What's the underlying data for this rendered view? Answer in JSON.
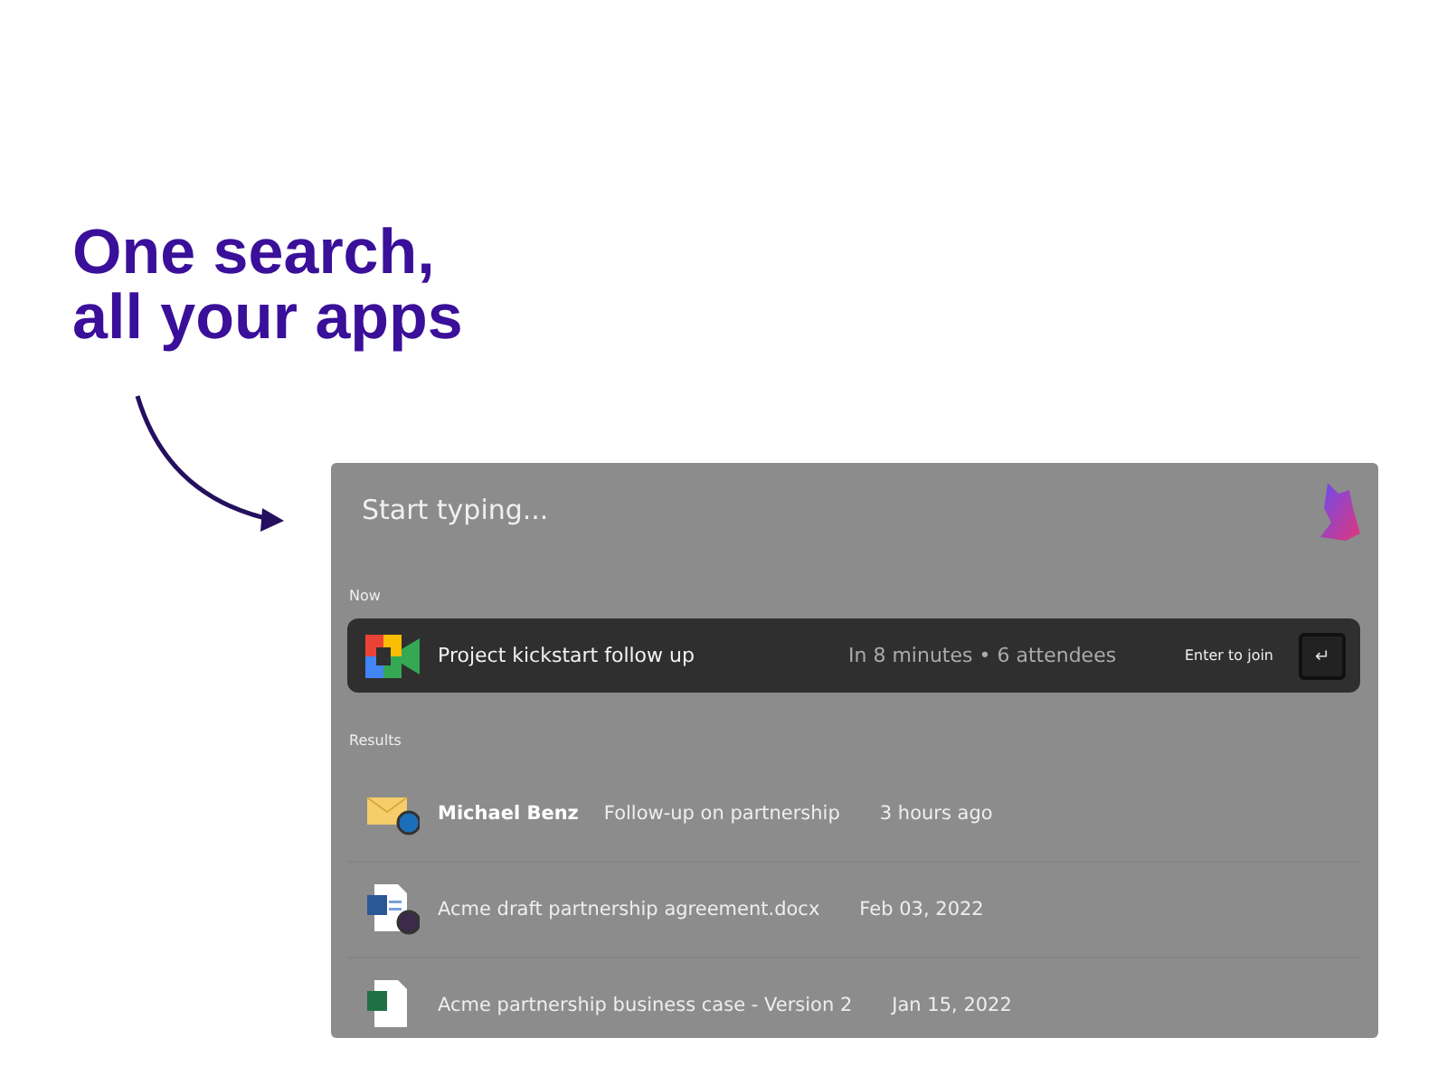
{
  "headline": "One search, all your apps",
  "search": {
    "placeholder": "Start typing..."
  },
  "now": {
    "label": "Now",
    "event": {
      "title": "Project kickstart follow up",
      "details": "In 8 minutes • 6 attendees",
      "hint": "Enter to join",
      "key": "↵"
    }
  },
  "results": {
    "label": "Results",
    "items": [
      {
        "kind": "email",
        "sender": "Michael Benz",
        "title": "Follow-up on partnership",
        "time": "3 hours ago"
      },
      {
        "kind": "word",
        "title": "Acme draft partnership agreement.docx",
        "time": "Feb 03, 2022"
      },
      {
        "kind": "sheet",
        "title": "Acme partnership business case - Version 2",
        "time": "Jan 15, 2022"
      }
    ]
  }
}
